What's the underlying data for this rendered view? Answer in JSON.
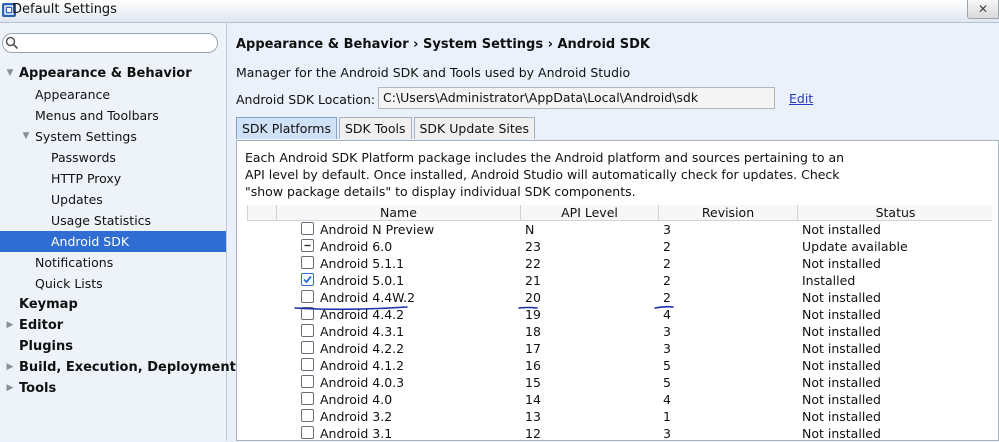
{
  "window": {
    "title": "Default Settings",
    "close_symbol": "✕"
  },
  "search": {
    "placeholder": ""
  },
  "tree": [
    {
      "label": "Appearance & Behavior",
      "level": 0,
      "bold": true,
      "expanded": true
    },
    {
      "label": "Appearance",
      "level": 1
    },
    {
      "label": "Menus and Toolbars",
      "level": 1
    },
    {
      "label": "System Settings",
      "level": 1,
      "expanded": true
    },
    {
      "label": "Passwords",
      "level": 2
    },
    {
      "label": "HTTP Proxy",
      "level": 2
    },
    {
      "label": "Updates",
      "level": 2
    },
    {
      "label": "Usage Statistics",
      "level": 2
    },
    {
      "label": "Android SDK",
      "level": 2,
      "selected": true
    },
    {
      "label": "Notifications",
      "level": 1
    },
    {
      "label": "Quick Lists",
      "level": 1
    },
    {
      "label": "Keymap",
      "level": 0,
      "bold": true
    },
    {
      "label": "Editor",
      "level": 0,
      "bold": true,
      "collapsed": true
    },
    {
      "label": "Plugins",
      "level": 0,
      "bold": true
    },
    {
      "label": "Build, Execution, Deployment",
      "level": 0,
      "bold": true,
      "collapsed": true
    },
    {
      "label": "Tools",
      "level": 0,
      "bold": true,
      "collapsed": true
    }
  ],
  "breadcrumb": "Appearance & Behavior › System Settings › Android SDK",
  "description": "Manager for the Android SDK and Tools used by Android Studio",
  "location": {
    "label": "Android SDK Location:",
    "value": "C:\\Users\\Administrator\\AppData\\Local\\Android\\sdk",
    "edit_label": "Edit"
  },
  "tabs": [
    {
      "label": "SDK Platforms",
      "active": true
    },
    {
      "label": "SDK Tools"
    },
    {
      "label": "SDK Update Sites"
    }
  ],
  "platform_info": "Each Android SDK Platform package includes the Android platform and sources pertaining to an API level by default. Once installed, Android Studio will automatically check for updates. Check \"show package details\" to display individual SDK components.",
  "table": {
    "columns": [
      "Name",
      "API Level",
      "Revision",
      "Status"
    ],
    "rows": [
      {
        "name": "Android N Preview",
        "api": "N",
        "rev": "3",
        "status": "Not installed",
        "check": "unchecked"
      },
      {
        "name": "Android 6.0",
        "api": "23",
        "rev": "2",
        "status": "Update available",
        "check": "partial"
      },
      {
        "name": "Android 5.1.1",
        "api": "22",
        "rev": "2",
        "status": "Not installed",
        "check": "unchecked"
      },
      {
        "name": "Android 5.0.1",
        "api": "21",
        "rev": "2",
        "status": "Installed",
        "check": "checked"
      },
      {
        "name": "Android 4.4W.2",
        "api": "20",
        "rev": "2",
        "status": "Not installed",
        "check": "unchecked"
      },
      {
        "name": "Android 4.4.2",
        "api": "19",
        "rev": "4",
        "status": "Not installed",
        "check": "unchecked"
      },
      {
        "name": "Android 4.3.1",
        "api": "18",
        "rev": "3",
        "status": "Not installed",
        "check": "unchecked"
      },
      {
        "name": "Android 4.2.2",
        "api": "17",
        "rev": "3",
        "status": "Not installed",
        "check": "unchecked"
      },
      {
        "name": "Android 4.1.2",
        "api": "16",
        "rev": "5",
        "status": "Not installed",
        "check": "unchecked"
      },
      {
        "name": "Android 4.0.3",
        "api": "15",
        "rev": "5",
        "status": "Not installed",
        "check": "unchecked"
      },
      {
        "name": "Android 4.0",
        "api": "14",
        "rev": "4",
        "status": "Not installed",
        "check": "unchecked"
      },
      {
        "name": "Android 3.2",
        "api": "13",
        "rev": "1",
        "status": "Not installed",
        "check": "unchecked"
      },
      {
        "name": "Android 3.1",
        "api": "12",
        "rev": "3",
        "status": "Not installed",
        "check": "unchecked"
      }
    ]
  },
  "colors": {
    "accent": "#2f6dd2",
    "annotation": "#1d2fa8",
    "link": "#2438c6"
  }
}
